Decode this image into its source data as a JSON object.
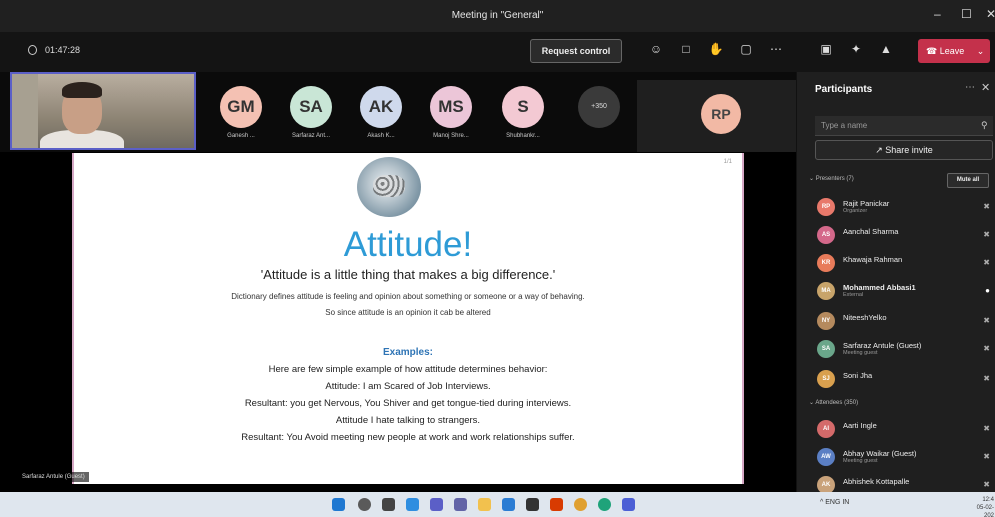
{
  "window": {
    "title": "Meeting in \"General\"",
    "minimize": "–",
    "maximize": "☐",
    "close": "✕"
  },
  "toolbar": {
    "timer": "01:47:28",
    "request_control": "Request control",
    "leave_label": "Leave",
    "icons": [
      "people-icon",
      "chat-icon",
      "raise-hand-icon",
      "rooms-icon",
      "more-icon",
      "camera-icon",
      "mic-icon",
      "share-icon"
    ]
  },
  "strip": {
    "attendees": [
      {
        "initials": "GM",
        "name": "Ganesh ...",
        "color": "#f4c1b3"
      },
      {
        "initials": "SA",
        "name": "Sarfaraz Ant...",
        "color": "#c9e6d6"
      },
      {
        "initials": "AK",
        "name": "Akash K...",
        "color": "#cfd9ec"
      },
      {
        "initials": "MS",
        "name": "Manoj Shre...",
        "color": "#ecc6d8"
      },
      {
        "initials": "S",
        "name": "Shubhankr...",
        "color": "#f3c9d3"
      }
    ],
    "overflow_count": "+350",
    "presenter_initials": "RP"
  },
  "slide": {
    "page_number": "1/1",
    "title": "Attitude!",
    "quote": "'Attitude is a little thing that makes a big difference.'",
    "definition": "Dictionary defines attitude is feeling and opinion about something or someone or a way of behaving.",
    "definition2": "So since attitude is an opinion it cab be altered",
    "examples_heading": "Examples:",
    "examples": [
      "Here are few simple example of how attitude determines behavior:",
      "Attitude: I am Scared of Job Interviews.",
      "Resultant: you get Nervous, You Shiver and get tongue-tied during interviews.",
      "Attitude I hate talking to strangers.",
      "Resultant: You Avoid meeting new people at work and work relationships suffer."
    ]
  },
  "self_video": {
    "name_tag": "Sarfaraz Antule (Guest)"
  },
  "panel": {
    "title": "Participants",
    "search_placeholder": "Type a name",
    "share_invite": "Share invite",
    "presenters_header": "Presenters (7)",
    "mute_all": "Mute all",
    "attendees_header": "Attendees (350)",
    "presenters": [
      {
        "initials": "RP",
        "name": "Rajit Panickar",
        "role": "Organizer",
        "color": "#e8796b"
      },
      {
        "initials": "AS",
        "name": "Aanchal Sharma",
        "role": "",
        "color": "#d4688a"
      },
      {
        "initials": "KR",
        "name": "Khawaja Rahman",
        "role": "",
        "color": "#e87b5a"
      },
      {
        "initials": "MA",
        "name": "Mohammed Abbasi1",
        "role": "External",
        "color": "#c8a46a"
      },
      {
        "initials": "NY",
        "name": "NiteeshYelko",
        "role": "",
        "color": "#b58a5e"
      },
      {
        "initials": "SA",
        "name": "Sarfaraz Antule (Guest)",
        "role": "Meeting guest",
        "color": "#6aa68a"
      },
      {
        "initials": "SJ",
        "name": "Soni Jha",
        "role": "",
        "color": "#d9a04e"
      }
    ],
    "attendees": [
      {
        "initials": "AI",
        "name": "Aarti Ingle",
        "role": "",
        "color": "#d46a6a"
      },
      {
        "initials": "AW",
        "name": "Abhay Waikar (Guest)",
        "role": "Meeting guest",
        "color": "#5b7fc4"
      },
      {
        "initials": "AK",
        "name": "Abhishek Kottapalle",
        "role": "",
        "color": "#c9a27a"
      }
    ]
  },
  "taskbar": {
    "tray_text": "^ ENG IN",
    "time": "12:4",
    "date": "05-02-202"
  }
}
